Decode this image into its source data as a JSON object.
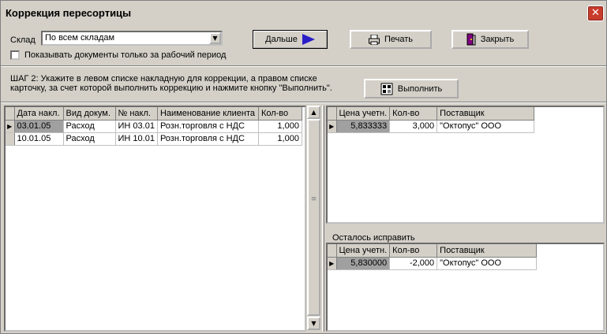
{
  "window": {
    "title": "Коррекция пересортицы",
    "close_symbol": "✕"
  },
  "warehouse": {
    "label": "Склад",
    "value": "По всем складам"
  },
  "checkbox": {
    "label": "Показывать документы только за рабочий период"
  },
  "buttons": {
    "next": "Дальше",
    "print": "Печать",
    "close": "Закрыть",
    "execute": "Выполнить"
  },
  "step_text": {
    "line1": "ШАГ 2: Укажите в левом списке накладную для коррекции, а правом списке",
    "line2": "карточку, за счет которой выполнить коррекцию и нажмите кнопку \"Выполнить\"."
  },
  "left_table": {
    "headers": [
      "Дата накл.",
      "Вид докум.",
      "№ накл.",
      "Наименование клиента",
      "Кол-во"
    ],
    "rows": [
      [
        "03.01.05",
        "Расход",
        "ИН 03.01",
        "Розн.торговля с НДС",
        "1,000"
      ],
      [
        "10.01.05",
        "Расход",
        "ИН 10.01",
        "Розн.торговля с НДС",
        "1,000"
      ]
    ]
  },
  "right_top_table": {
    "headers": [
      "Цена учетн.",
      "Кол-во",
      "Поставщик"
    ],
    "rows": [
      [
        "5,833333",
        "3,000",
        "\"Октопус\" ООО"
      ]
    ]
  },
  "remaining_label": "Осталось исправить",
  "right_bottom_table": {
    "headers": [
      "Цена учетн.",
      "Кол-во",
      "Поставщик"
    ],
    "rows": [
      [
        "5,830000",
        "-2,000",
        "\"Октопус\" ООО"
      ]
    ]
  }
}
